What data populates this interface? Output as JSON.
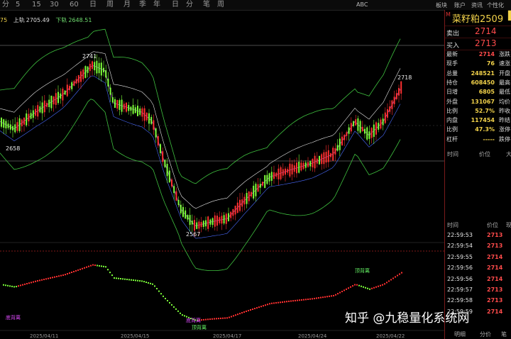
{
  "toolbar": {
    "periods": [
      "分",
      "5",
      "15",
      "30",
      "60",
      "日",
      "周",
      "月",
      "季",
      "年",
      "日",
      "分",
      "笔",
      "周"
    ],
    "right": [
      "ABC",
      "板块",
      "账户",
      "资讯",
      "个性化"
    ]
  },
  "chart_info": {
    "prefix": "75",
    "upper_label": "上轨",
    "upper_value": "2705.49",
    "lower_label": "下轨",
    "lower_value": "2648.51"
  },
  "chart_data": {
    "type": "candlestick",
    "title": "",
    "x_ticks": [
      "2025/04/11",
      "2025/04/15",
      "2025/04/17",
      "2025/04/24",
      "2025/04/22"
    ],
    "annotations": [
      {
        "text": "2741",
        "at": "high"
      },
      {
        "text": "2658",
        "at": "left-low"
      },
      {
        "text": "2567",
        "at": "low"
      },
      {
        "text": "2718",
        "at": "last-high"
      }
    ],
    "price_range": [
      2540,
      2770
    ],
    "key_prices": [
      2741,
      2658,
      2567,
      2718
    ],
    "indicator_labels": [
      "底背离",
      "底背离",
      "顶背离",
      "顶背离"
    ],
    "colors": {
      "up": "#ff3030",
      "down": "#7dff3a",
      "band": "#3fc13f",
      "mid": "#9a52c9"
    }
  },
  "quote": {
    "symbol": "菜籽粕2509",
    "sell_label": "卖出",
    "sell_price": "2714",
    "buy_label": "买入",
    "buy_price": "2713",
    "rows": [
      {
        "label": "最新",
        "value": "2714",
        "right": "涨跌"
      },
      {
        "label": "现手",
        "value": "76",
        "right": "速涨"
      },
      {
        "label": "总量",
        "value": "248521",
        "right": "开盘"
      },
      {
        "label": "持仓",
        "value": "608450",
        "right": "最高"
      },
      {
        "label": "日增",
        "value": "6805",
        "right": "最低"
      },
      {
        "label": "外盘",
        "value": "131067",
        "right": "均价"
      },
      {
        "label": "比例",
        "value": "52.7%",
        "right": "昨收"
      },
      {
        "label": "内盘",
        "value": "117454",
        "right": "昨结"
      },
      {
        "label": "比例",
        "value": "47.3%",
        "right": "涨停"
      },
      {
        "label": "杠杆",
        "value": "-----",
        "right": "跌停"
      }
    ]
  },
  "ticks": {
    "headers": [
      "时间",
      "价位",
      "大"
    ],
    "headers2": [
      "时间",
      "价位",
      "现"
    ],
    "rows": [
      {
        "time": "22:59:53",
        "price": "2713"
      },
      {
        "time": "22:59:54",
        "price": "2713"
      },
      {
        "time": "22:59:55",
        "price": "2714"
      },
      {
        "time": "22:59:56",
        "price": "2714"
      },
      {
        "time": "22:59:56",
        "price": "2714"
      },
      {
        "time": "22:59:57",
        "price": "2713"
      },
      {
        "time": "22:59:58",
        "price": "2713"
      },
      {
        "time": "22:59:59",
        "price": "2714"
      }
    ]
  },
  "bottom_tabs": [
    "明细",
    "分价",
    "笔"
  ],
  "watermark": "知乎 @九稳量化系统网"
}
